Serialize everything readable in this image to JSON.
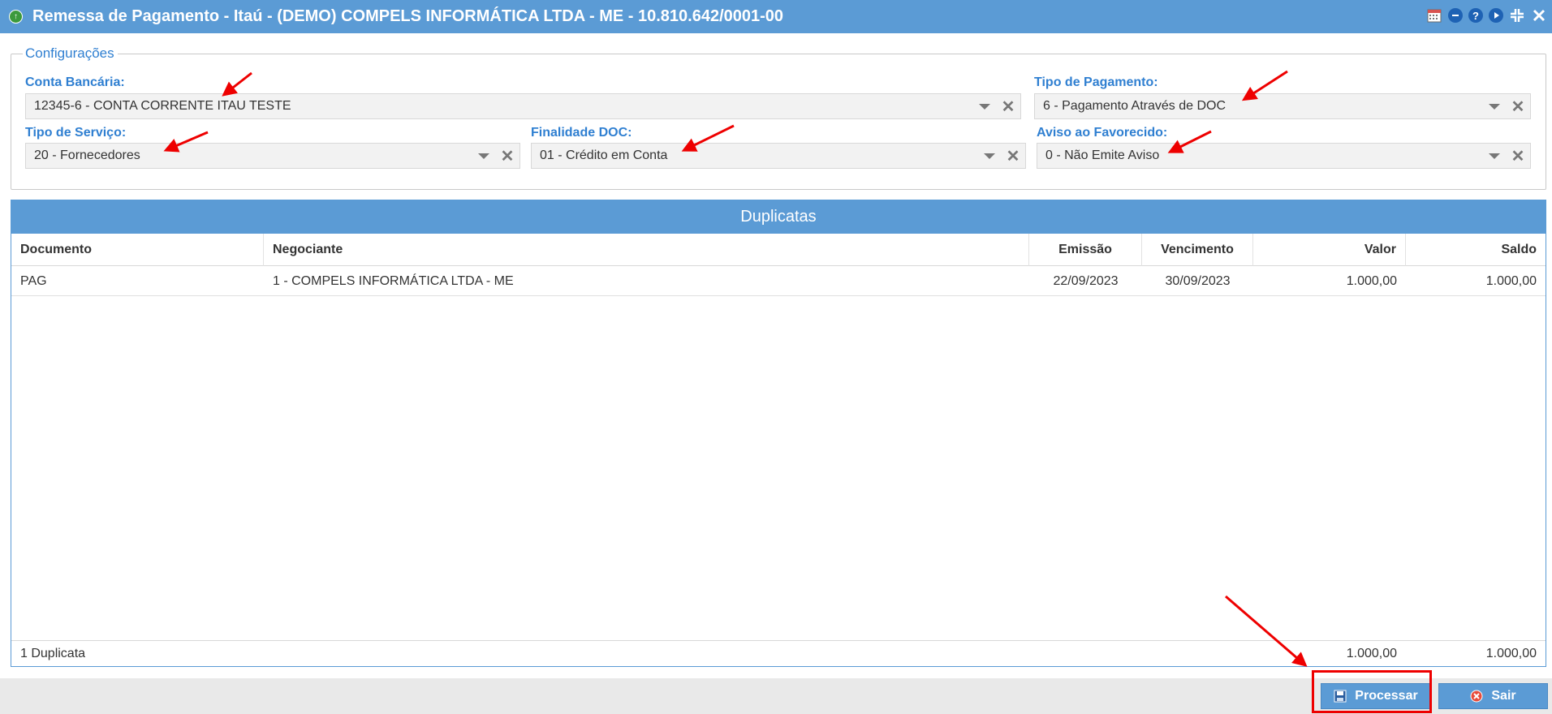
{
  "window": {
    "title": "Remessa de Pagamento - Itaú - (DEMO) COMPELS INFORMÁTICA LTDA - ME - 10.810.642/0001-00",
    "tools": [
      "calendar-icon",
      "minimize-icon",
      "help-icon",
      "play-icon",
      "collapse-icon",
      "close-icon"
    ],
    "help_glyph": "?"
  },
  "config": {
    "legend": "Configurações",
    "conta_bancaria": {
      "label": "Conta Bancária:",
      "value": "12345-6 - CONTA CORRENTE ITAU TESTE"
    },
    "tipo_pagamento": {
      "label": "Tipo de Pagamento:",
      "value": "6 - Pagamento Através de DOC"
    },
    "tipo_servico": {
      "label": "Tipo de Serviço:",
      "value": "20 - Fornecedores"
    },
    "finalidade_doc": {
      "label": "Finalidade DOC:",
      "value": "01 - Crédito em Conta"
    },
    "aviso_favorecido": {
      "label": "Aviso ao Favorecido:",
      "value": "0 - Não Emite Aviso"
    }
  },
  "grid": {
    "title": "Duplicatas",
    "columns": [
      "Documento",
      "Negociante",
      "Emissão",
      "Vencimento",
      "Valor",
      "Saldo"
    ],
    "rows": [
      [
        "PAG",
        "1 - COMPELS INFORMÁTICA LTDA - ME",
        "22/09/2023",
        "30/09/2023",
        "1.000,00",
        "1.000,00"
      ]
    ],
    "footer": {
      "count": "1 Duplicata",
      "valor_total": "1.000,00",
      "saldo_total": "1.000,00"
    }
  },
  "actions": {
    "processar": "Processar",
    "sair": "Sair"
  },
  "colors": {
    "header_blue": "#5b9bd5",
    "label_blue": "#2f7fd1",
    "annotation_red": "#ee0000"
  }
}
